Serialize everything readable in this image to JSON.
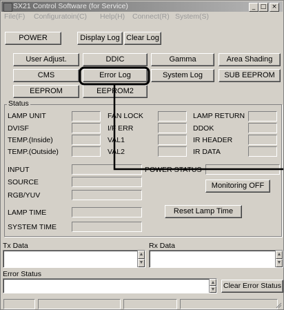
{
  "window": {
    "title": "SX21 Control Software (for Service)",
    "buttons": {
      "minimize": "_",
      "maximize": "□",
      "close": "×"
    }
  },
  "menu": [
    "File(F)",
    "Configuratoin(C)",
    "Help(H)",
    "Connect(R)",
    "System(S)"
  ],
  "toolbar": {
    "power": "POWER",
    "display_log": "Display Log",
    "clear_log": "Clear Log"
  },
  "function_buttons": {
    "user_adjust": "User Adjust.",
    "ddic": "DDIC",
    "gamma": "Gamma",
    "area_shading": "Area Shading",
    "cms": "CMS",
    "error_log": "Error Log",
    "system_log": "System Log",
    "sub_eeprom": "SUB EEPROM",
    "eeprom": "EEPROM",
    "eeprom2": "EEPROM2"
  },
  "status": {
    "group_label": "Status",
    "col1": [
      "LAMP UNIT",
      "DVISF",
      "TEMP.(Inside)",
      "TEMP.(Outside)"
    ],
    "col2": [
      "FAN LOCK",
      "I/F ERR",
      "VAL1",
      "VAL2"
    ],
    "col3": [
      "LAMP RETURN",
      "DDOK",
      "IR HEADER",
      "IR DATA"
    ],
    "input": "INPUT",
    "source": "SOURCE",
    "rgb_yuv": "RGB/YUV",
    "power_status": "POWER STATUS",
    "monitoring_off": "Monitoring OFF",
    "lamp_time": "LAMP TIME",
    "reset_lamp_time": "Reset Lamp Time",
    "system_time": "SYSTEM TIME"
  },
  "tx_data": {
    "label": "Tx Data",
    "value": ""
  },
  "rx_data": {
    "label": "Rx Data",
    "value": ""
  },
  "error_status": {
    "label": "Error Status",
    "value": "",
    "clear_button": "Clear Error Status"
  }
}
